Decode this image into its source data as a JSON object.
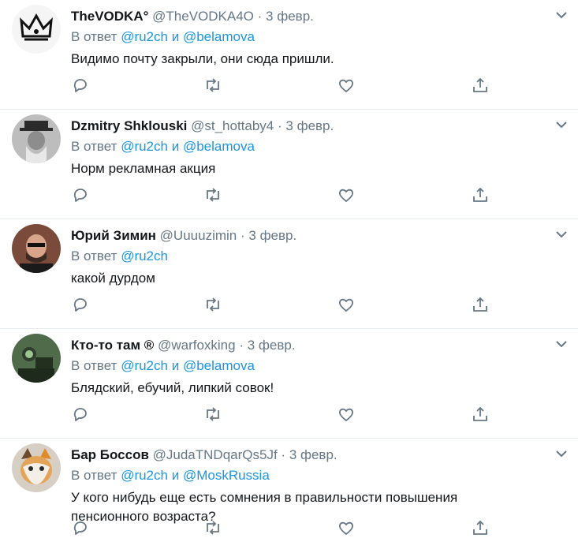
{
  "reply_prefix": "В ответ",
  "and_word": "и",
  "dot": "·",
  "icons": [
    "reply-icon",
    "retweet-icon",
    "like-icon",
    "share-icon",
    "chevron-down-icon"
  ],
  "colors": {
    "link": "#1b95e0",
    "muted": "#657786",
    "text": "#14171a",
    "divider": "#e6ecf0"
  },
  "tweets": [
    {
      "name": "TheVODKA°",
      "handle": "@TheVODKA4O",
      "date": "3 февр.",
      "reply_to": [
        "@ru2ch",
        "@belamova"
      ],
      "text": "Видимо почту закрыли, они сюда пришли."
    },
    {
      "name": "Dzmitry Shklouski",
      "handle": "@st_hottaby4",
      "date": "3 февр.",
      "reply_to": [
        "@ru2ch",
        "@belamova"
      ],
      "text": "Норм рекламная акция"
    },
    {
      "name": "Юрий Зимин",
      "handle": "@Uuuuzimin",
      "date": "3 февр.",
      "reply_to": [
        "@ru2ch"
      ],
      "text": "какой дурдом"
    },
    {
      "name": "Кто-то там ®",
      "handle": "@warfoxking",
      "date": "3 февр.",
      "reply_to": [
        "@ru2ch",
        "@belamova"
      ],
      "text": "Блядский, ебучий, липкий совок!"
    },
    {
      "name": "Бар Боссов",
      "handle": "@JudaTNDqarQs5Jf",
      "date": "3 февр.",
      "reply_to": [
        "@ru2ch",
        "@MoskRussia"
      ],
      "text": "У кого нибудь еще есть сомнения в правильности повышения пенсионного возраста?"
    }
  ]
}
